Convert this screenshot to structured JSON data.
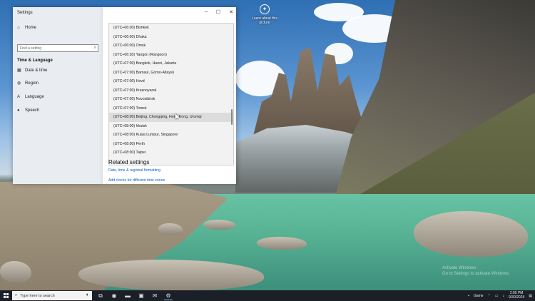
{
  "desktop": {
    "icon_label": "Learn about this picture",
    "icon": "camera-icon",
    "watermark_line1": "Activate Windows",
    "watermark_line2": "Go to Settings to activate Windows."
  },
  "settings": {
    "window_title": "Settings",
    "home_label": "Home",
    "search_placeholder": "Find a setting",
    "section_heading": "Time & Language",
    "nav": [
      {
        "label": "Date & time",
        "icon": "calendar-clock-icon"
      },
      {
        "label": "Region",
        "icon": "globe-icon"
      },
      {
        "label": "Language",
        "icon": "language-icon"
      },
      {
        "label": "Speech",
        "icon": "microphone-icon"
      }
    ],
    "window_controls": {
      "minimize": "–",
      "maximize": "☐",
      "close": "✕"
    },
    "timezones": [
      "(UTC+06:00) Bishkek",
      "(UTC+06:00) Dhaka",
      "(UTC+06:00) Omsk",
      "(UTC+06:30) Yangon (Rangoon)",
      "(UTC+07:00) Bangkok, Hanoi, Jakarta",
      "(UTC+07:00) Barnaul, Gorno-Altaysk",
      "(UTC+07:00) Hovd",
      "(UTC+07:00) Krasnoyarsk",
      "(UTC+07:00) Novosibirsk",
      "(UTC+07:00) Tomsk",
      "(UTC+08:00) Beijing, Chongqing, Hong Kong, Urumqi",
      "(UTC+08:00) Irkutsk",
      "(UTC+08:00) Kuala Lumpur, Singapore",
      "(UTC+08:00) Perth",
      "(UTC+08:00) Taipei"
    ],
    "selected_index": 10,
    "related_heading": "Related settings",
    "links": [
      "Date, time & regional formatting",
      "Add clocks for different time zones"
    ]
  },
  "taskbar": {
    "search_placeholder": "Type here to search",
    "apps": [
      {
        "name": "task-view-icon",
        "glyph": "⧉"
      },
      {
        "name": "edge-icon",
        "glyph": "◉"
      },
      {
        "name": "file-explorer-icon",
        "glyph": "▬"
      },
      {
        "name": "store-icon",
        "glyph": "▣"
      },
      {
        "name": "mail-icon",
        "glyph": "✉"
      },
      {
        "name": "settings-app-icon",
        "glyph": "⚙"
      }
    ],
    "tray_app_label": "Game",
    "time": "2:05 PM",
    "date": "9/30/2024",
    "accent": "#7ab6f2"
  }
}
